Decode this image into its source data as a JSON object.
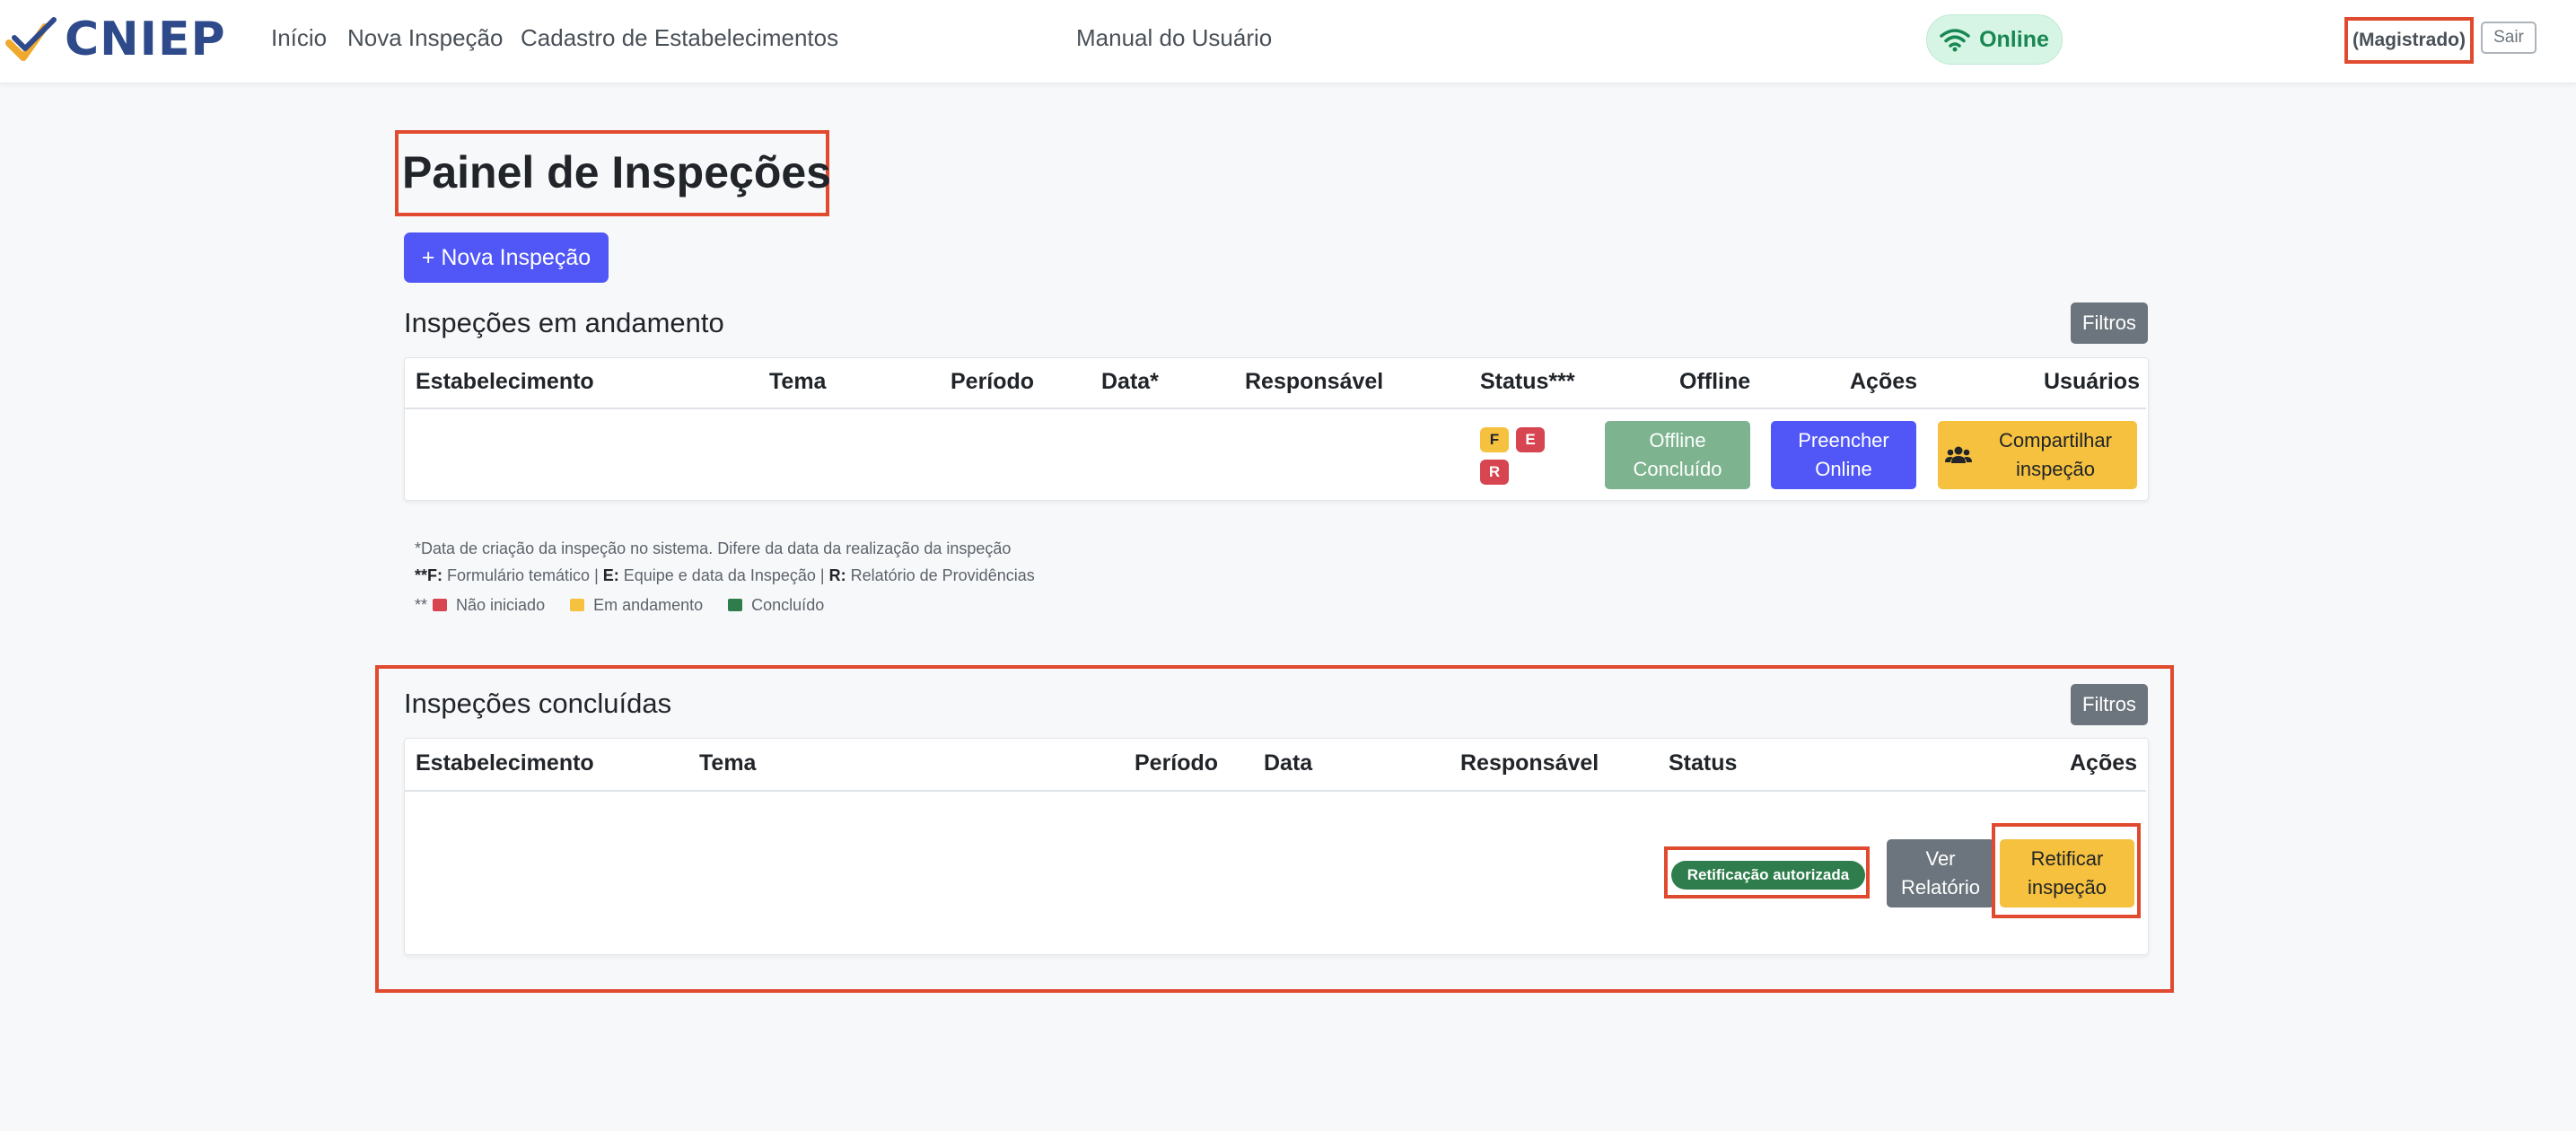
{
  "app": {
    "brand": "CNIEP",
    "colors": {
      "accent": "#5057f6",
      "success": "#198754",
      "warning": "#f5c13e",
      "danger": "#d64550"
    }
  },
  "nav": {
    "links": [
      "Início",
      "Nova Inspeção",
      "Cadastro de Estabelecimentos",
      "Manual do Usuário"
    ],
    "status": "Online",
    "status_icon": "wifi-icon",
    "user_role": "(Magistrado)",
    "logout": "Sair"
  },
  "page": {
    "title": "Painel de Inspeções",
    "new_button": "+ Nova Inspeção"
  },
  "ongoing": {
    "title": "Inspeções em andamento",
    "filter": "Filtros",
    "headers": [
      "Estabelecimento",
      "Tema",
      "Período",
      "Data*",
      "Responsável",
      "Status***",
      "Offline",
      "Ações",
      "Usuários"
    ],
    "row": {
      "badges": [
        "F",
        "E",
        "R"
      ],
      "offline": "Offline Concluído",
      "action": "Preencher Online",
      "share_icon": "users-icon",
      "share": "Compartilhar inspeção"
    },
    "notes": {
      "line1": "*Data de criação da inspeção no sistema. Difere da data da realização da inspeção",
      "line2_prefix": "**",
      "f_key": "F:",
      "f_text": " Formulário temático | ",
      "e_key": "E:",
      "e_text": " Equipe e data da Inspeção | ",
      "r_key": "R:",
      "r_text": " Relatório de Providências",
      "legend_prefix": "**",
      "legend": [
        "Não iniciado",
        "Em andamento",
        "Concluído"
      ]
    }
  },
  "completed": {
    "title": "Inspeções concluídas",
    "filter": "Filtros",
    "headers": [
      "Estabelecimento",
      "Tema",
      "Período",
      "Data",
      "Responsável",
      "Status",
      "Ações"
    ],
    "row": {
      "status": "Retificação autorizada",
      "view": "Ver Relatório",
      "rectify": "Retificar inspeção"
    }
  }
}
